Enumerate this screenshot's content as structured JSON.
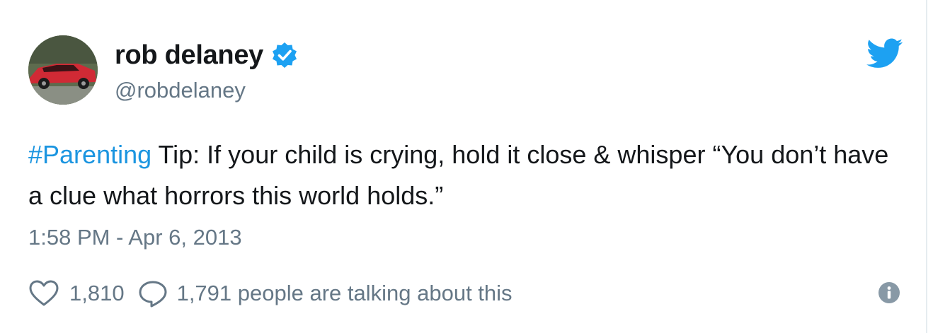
{
  "author": {
    "display_name": "rob delaney",
    "handle": "@robdelaney",
    "verified": true,
    "avatar_icon": "avatar-red-car"
  },
  "tweet": {
    "hashtag": "#Parenting",
    "text": " Tip: If your child is crying, hold it close & whisper “You don’t have a clue what horrors this world holds.”",
    "timestamp": "1:58 PM - Apr 6, 2013"
  },
  "actions": {
    "like_count": "1,810",
    "talking_text": "1,791 people are talking about this"
  },
  "icons": {
    "brand": "twitter-bird-icon",
    "verified": "verified-badge-icon",
    "like": "heart-icon",
    "reply": "reply-bubble-icon",
    "info": "info-icon"
  },
  "colors": {
    "brand_blue": "#1da1f2",
    "link_blue": "#1b95e0",
    "text": "#14171a",
    "muted": "#657786"
  }
}
